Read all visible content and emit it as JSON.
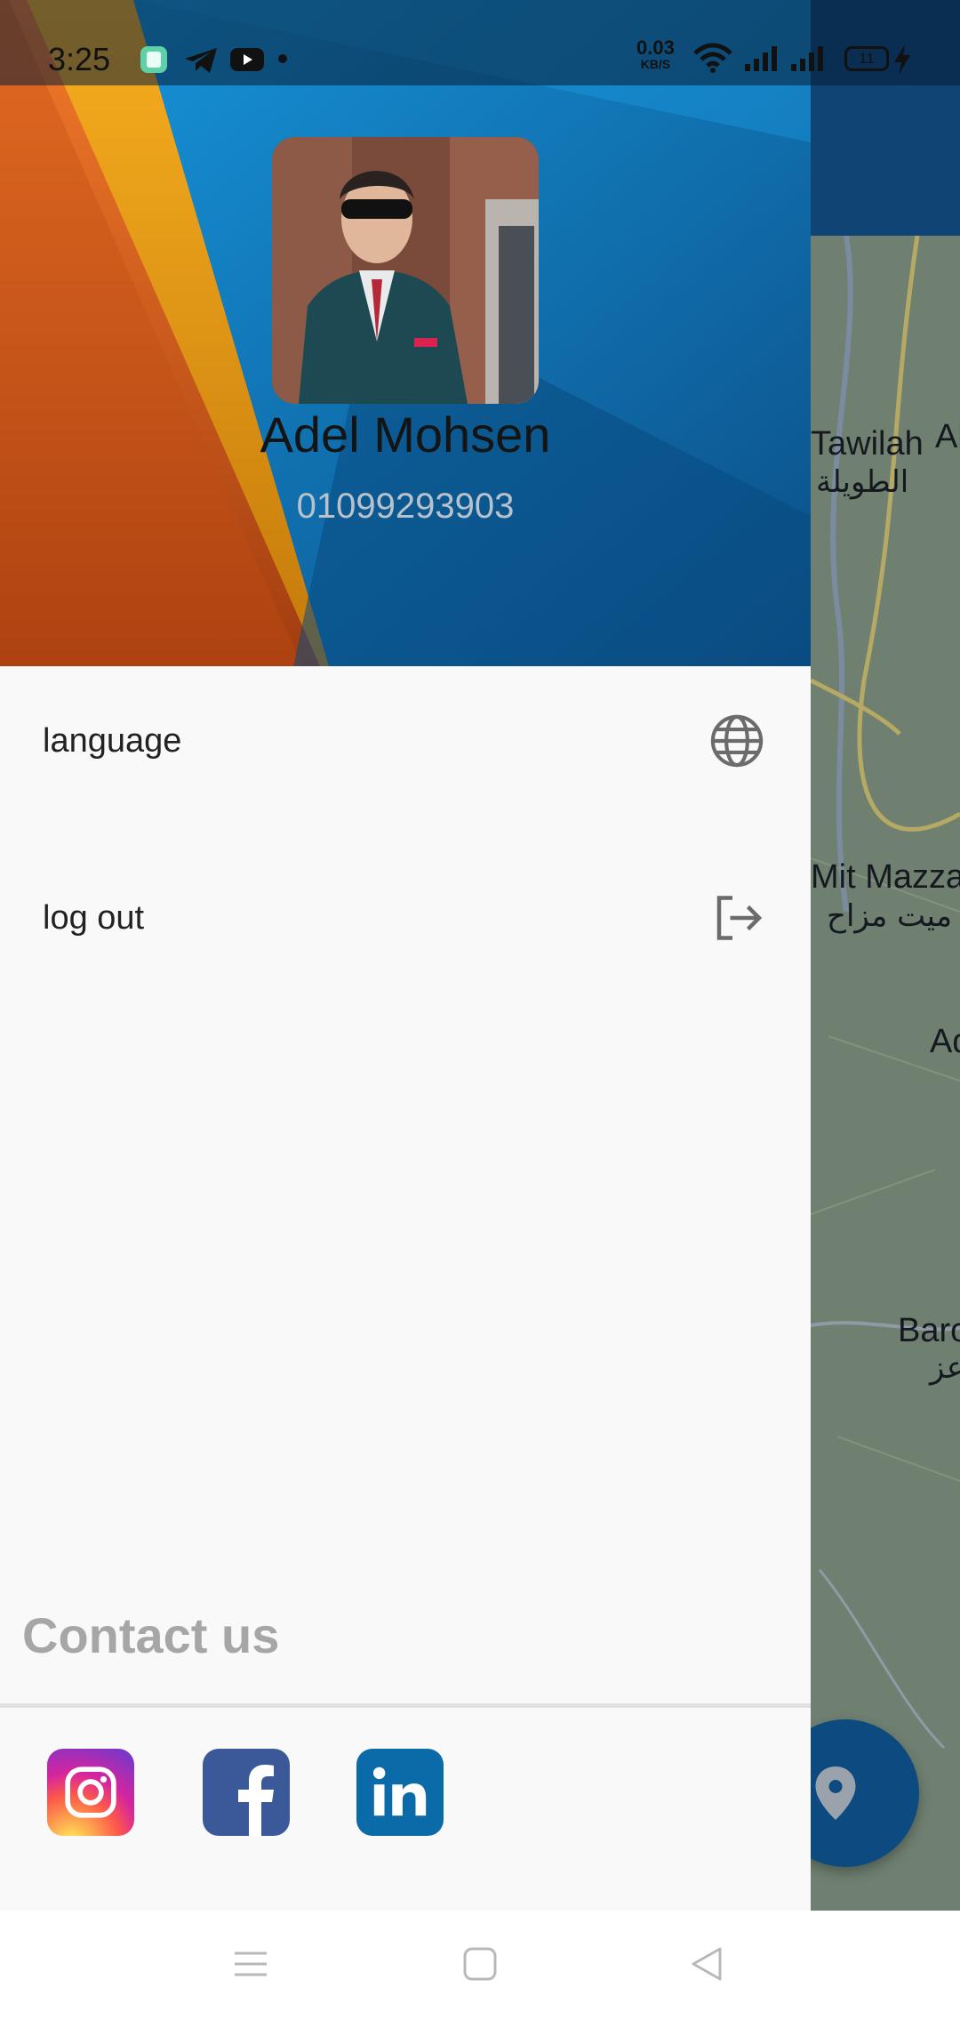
{
  "status_bar": {
    "time": "3:25",
    "net_speed_value": "0.03",
    "net_speed_unit": "KB/S",
    "battery": "11",
    "icons": [
      "notification-app-icon",
      "telegram-icon",
      "youtube-icon",
      "dot-icon",
      "wifi-icon",
      "signal-icon",
      "signal-icon",
      "battery-icon",
      "charging-icon"
    ]
  },
  "drawer": {
    "user": {
      "name": "Adel Mohsen",
      "phone": "01099293903"
    },
    "menu": [
      {
        "label": "language",
        "icon": "globe-icon"
      },
      {
        "label": "log out",
        "icon": "logout-icon"
      }
    ],
    "contact": {
      "title": "Contact us",
      "socials": [
        "instagram",
        "facebook",
        "linkedin"
      ]
    }
  },
  "map": {
    "labels": [
      {
        "text": "Tawilah",
        "lang": "en"
      },
      {
        "text": "Al",
        "lang": "en"
      },
      {
        "text": "الطويلة",
        "lang": "ar"
      },
      {
        "text": "Mit Mazza",
        "lang": "en"
      },
      {
        "text": "ميت مزاح",
        "lang": "ar"
      },
      {
        "text": "Ad",
        "lang": "en"
      },
      {
        "text": "Baro",
        "lang": "en"
      },
      {
        "text": "عز",
        "lang": "ar"
      }
    ]
  },
  "nav_bar": {
    "buttons": [
      "menu-icon",
      "home-icon",
      "back-icon"
    ]
  },
  "colors": {
    "drawer_bg": "#f9f9f9",
    "header_blue": "#0e6fb5",
    "header_orange": "#f07826",
    "header_yellow": "#f5a81c",
    "fab": "#0d4a80",
    "map": "#6f8070",
    "contact_text": "#a6a6a6"
  }
}
